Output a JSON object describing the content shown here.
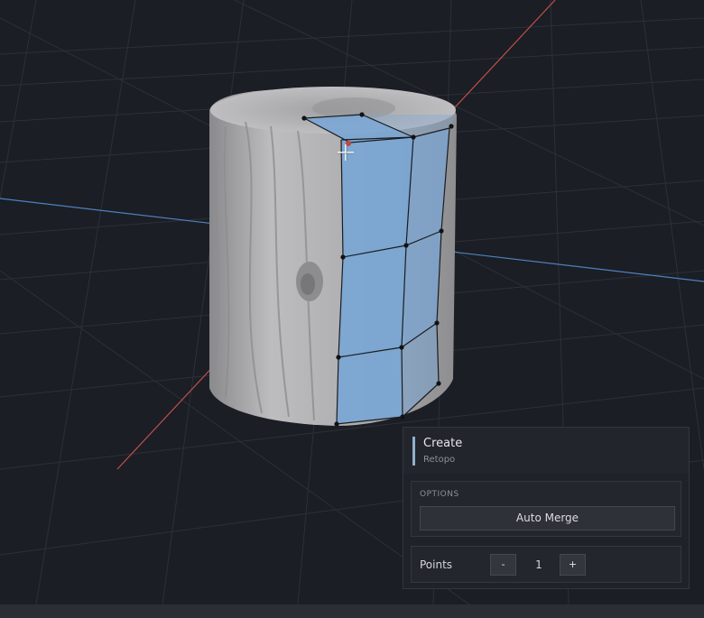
{
  "panel": {
    "title": "Create",
    "subtitle": "Retopo",
    "options_label": "OPTIONS",
    "auto_merge_label": "Auto Merge",
    "points_label": "Points",
    "decrement_label": "-",
    "increment_label": "+",
    "points_value": "1"
  },
  "colors": {
    "viewport_bg": "#1b1e24",
    "grid": "#2a2e36",
    "axis_x": "#c0504a",
    "axis_z": "#4b82c0",
    "mesh": "#a6a6a8",
    "retopo_faces": "#7aa6d4",
    "panel_accent": "#8fb0d0"
  },
  "icons": {
    "cursor": "crosshair-cursor-icon"
  }
}
